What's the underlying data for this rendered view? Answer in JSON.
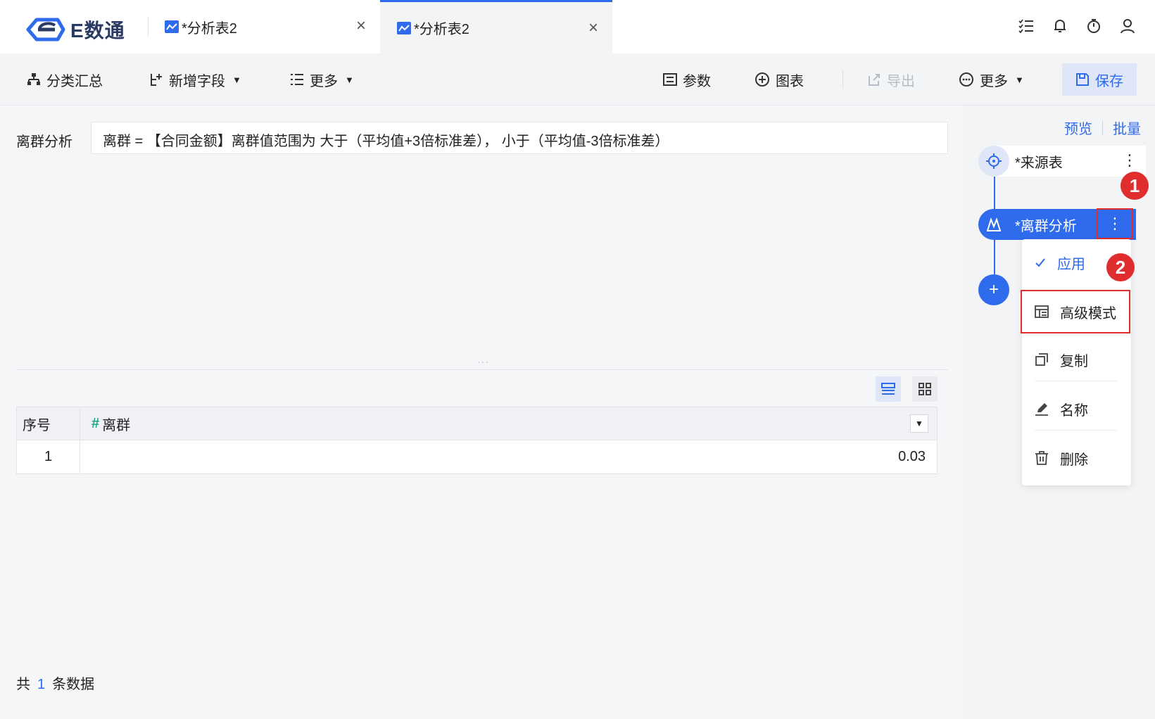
{
  "brand": {
    "name": "E数通",
    "color": "#2b3a63"
  },
  "tabs": [
    {
      "label": "*分析表2",
      "active": false
    },
    {
      "label": "*分析表2",
      "active": true
    }
  ],
  "top_icons": [
    "list-check-icon",
    "bell-icon",
    "timer-icon",
    "user-icon"
  ],
  "toolbar": {
    "group_summary": "分类汇总",
    "add_field": "新增字段",
    "more_left": "更多",
    "params": "参数",
    "chart": "图表",
    "export": "导出",
    "more_right": "更多",
    "save": "保存"
  },
  "formula": {
    "label": "离群分析",
    "value": "离群 = 【合同金额】离群值范围为 大于（平均值+3倍标准差）， 小于（平均值-3倍标准差）"
  },
  "table": {
    "columns": [
      "序号",
      "离群"
    ],
    "rows": [
      {
        "index": "1",
        "value": "0.03"
      }
    ]
  },
  "footer": {
    "prefix": "共",
    "count": "1",
    "suffix": "条数据"
  },
  "right_panel": {
    "preview": "预览",
    "batch": "批量",
    "nodes": [
      {
        "label": "*来源表"
      },
      {
        "label": "*离群分析"
      }
    ]
  },
  "context_menu": {
    "apply": "应用",
    "advanced": "高级模式",
    "copy": "复制",
    "rename": "名称",
    "delete": "删除"
  },
  "badges": [
    "1",
    "2"
  ],
  "colors": {
    "accent": "#2f6bed",
    "highlight": "#e02d2d",
    "field_icon": "#1aa889"
  }
}
